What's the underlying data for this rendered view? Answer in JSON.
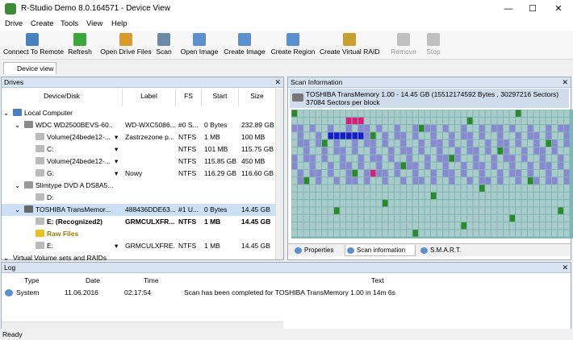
{
  "title": "R-Studio Demo 8.0.164571 - Device View",
  "window": {
    "min": "—",
    "max": "☐",
    "close": "✕"
  },
  "menu": [
    "Drive",
    "Create",
    "Tools",
    "View",
    "Help"
  ],
  "toolbar": [
    {
      "label": "Connect To Remote",
      "color": "#4a7fc0"
    },
    {
      "label": "Refresh",
      "color": "#3aa83a"
    },
    {
      "label": "Open Drive Files",
      "color": "#d89a2a"
    },
    {
      "label": "Scan",
      "color": "#6a8aa8"
    },
    {
      "label": "Open Image",
      "color": "#5a8fd0"
    },
    {
      "label": "Create Image",
      "color": "#5a8fd0"
    },
    {
      "label": "Create Region",
      "color": "#5a8fd0"
    },
    {
      "label": "Create Virtual RAID",
      "color": "#c8a030"
    },
    {
      "label": "Remove",
      "color": "#c0c0c0"
    },
    {
      "label": "Stop",
      "color": "#c0c0c0"
    }
  ],
  "tab": "Device view",
  "drives": {
    "title": "Drives",
    "columns": [
      "Device/Disk",
      "Label",
      "FS",
      "Start",
      "Size"
    ],
    "rows": [
      {
        "c": [
          "Local Computer",
          "",
          "",
          "",
          ""
        ],
        "icon": "computer-icon",
        "level": 0,
        "exp": "⌄",
        "color": "#4a7fc0"
      },
      {
        "c": [
          "WDC WD2500BEVS-60...",
          "WD-WXC5086...",
          "#0 S...",
          "0 Bytes",
          "232.89 GB"
        ],
        "icon": "hdd-icon",
        "level": 1,
        "exp": "⌄",
        "color": "#888"
      },
      {
        "c": [
          "Volume{24bede12-...",
          "Zastrzezone p...",
          "NTFS",
          "1 MB",
          "100 MB"
        ],
        "icon": "volume-icon",
        "level": 2,
        "dd": "▾",
        "color": "#bbb"
      },
      {
        "c": [
          "C:",
          "",
          "NTFS",
          "101 MB",
          "115.75 GB"
        ],
        "icon": "volume-icon",
        "level": 2,
        "dd": "▾",
        "color": "#bbb"
      },
      {
        "c": [
          "Volume{24bede12-...",
          "",
          "NTFS",
          "115.85 GB",
          "450 MB"
        ],
        "icon": "volume-icon",
        "level": 2,
        "dd": "▾",
        "color": "#bbb"
      },
      {
        "c": [
          "G:",
          "Nowy",
          "NTFS",
          "116.29 GB",
          "116.60 GB"
        ],
        "icon": "volume-icon",
        "level": 2,
        "dd": "▾",
        "color": "#bbb"
      },
      {
        "c": [
          "Slimtype DVD A DS8A5...",
          "",
          "",
          "",
          ""
        ],
        "icon": "dvd-icon",
        "level": 1,
        "exp": "⌄",
        "color": "#999"
      },
      {
        "c": [
          "D:",
          "",
          "",
          "",
          ""
        ],
        "icon": "volume-icon",
        "level": 2,
        "color": "#bbb"
      },
      {
        "c": [
          "TOSHIBA TransMemor...",
          "488436DDE63...",
          "#1 U...",
          "0 Bytes",
          "14.45 GB"
        ],
        "icon": "usb-icon",
        "level": 1,
        "exp": "⌄",
        "color": "#666",
        "sel": true
      },
      {
        "c": [
          "E: (Recognized2)",
          "GRMCULXFR...",
          "NTFS",
          "1 MB",
          "14.45 GB"
        ],
        "icon": "volume-icon",
        "level": 2,
        "bold": true,
        "color": "#bbb"
      },
      {
        "c": [
          "Raw Files",
          "",
          "",
          "",
          ""
        ],
        "icon": "raw-files-icon",
        "level": 2,
        "raw": true,
        "color": "#e8c020"
      },
      {
        "c": [
          "E:",
          "GRMCULXFRE...",
          "NTFS",
          "1 MB",
          "14.45 GB"
        ],
        "icon": "volume-icon",
        "level": 2,
        "dd": "▾",
        "color": "#bbb"
      },
      {
        "c": [
          "Virtual Volume sets and RAIDs",
          "",
          "",
          "",
          ""
        ],
        "icon": "",
        "level": 0,
        "exp": "⌄",
        "color": ""
      }
    ]
  },
  "scan": {
    "title": "Scan Information",
    "header": "TOSHIBA TransMemory 1.00 - 14.45 GB (15512174592 Bytes , 30297216 Sectors) 37084 Sectors per block",
    "tabs": [
      "Properties",
      "Scan information",
      "S.M.A.R.T."
    ]
  },
  "log": {
    "title": "Log",
    "columns": [
      "Type",
      "Date",
      "Time",
      "Text"
    ],
    "rows": [
      {
        "type": "System",
        "date": "11.06.2016",
        "time": "02:17:54",
        "text": "Scan has been completed for TOSHIBA TransMemory 1.00 in 14m 6s"
      }
    ]
  },
  "status": "Ready"
}
